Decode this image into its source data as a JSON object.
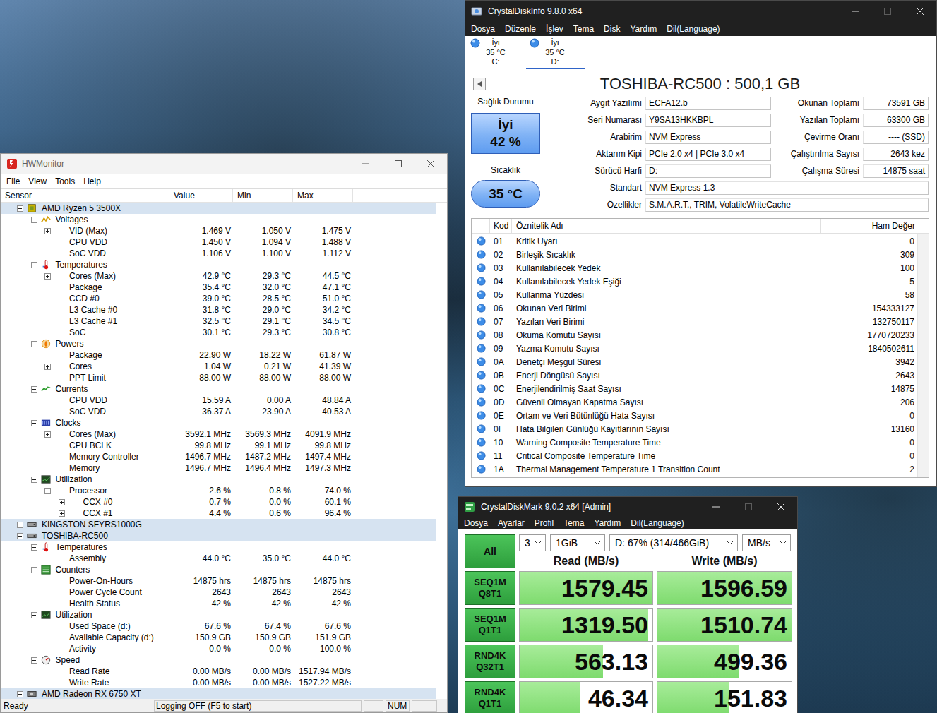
{
  "hwmonitor": {
    "title": "HWMonitor",
    "menu": [
      "File",
      "View",
      "Tools",
      "Help"
    ],
    "columns": [
      "Sensor",
      "Value",
      "Min",
      "Max"
    ],
    "rows": [
      {
        "label": "AMD Ryzen 5 3500X",
        "kind": "cpu",
        "level": 1,
        "expandable": true,
        "expanded": true
      },
      {
        "label": "Voltages",
        "kind": "voltages",
        "level": 2,
        "expandable": true,
        "expanded": true
      },
      {
        "label": "VID (Max)",
        "kind": "sensor",
        "level": 3,
        "expandable": true,
        "expanded": false,
        "value": "1.469 V",
        "min": "1.050 V",
        "max": "1.475 V"
      },
      {
        "label": "CPU VDD",
        "kind": "sensor",
        "level": 3,
        "expandable": false,
        "expanded": false,
        "value": "1.450 V",
        "min": "1.094 V",
        "max": "1.488 V"
      },
      {
        "label": "SoC VDD",
        "kind": "sensor",
        "level": 3,
        "expandable": false,
        "expanded": false,
        "value": "1.106 V",
        "min": "1.100 V",
        "max": "1.112 V"
      },
      {
        "label": "Temperatures",
        "kind": "temperatures",
        "level": 2,
        "expandable": true,
        "expanded": true
      },
      {
        "label": "Cores (Max)",
        "kind": "sensor",
        "level": 3,
        "expandable": true,
        "expanded": false,
        "value": "42.9 °C",
        "min": "29.3 °C",
        "max": "44.5 °C"
      },
      {
        "label": "Package",
        "kind": "sensor",
        "level": 3,
        "expandable": false,
        "expanded": false,
        "value": "35.4 °C",
        "min": "32.0 °C",
        "max": "47.1 °C"
      },
      {
        "label": "CCD #0",
        "kind": "sensor",
        "level": 3,
        "expandable": false,
        "expanded": false,
        "value": "39.0 °C",
        "min": "28.5 °C",
        "max": "51.0 °C"
      },
      {
        "label": "L3 Cache #0",
        "kind": "sensor",
        "level": 3,
        "expandable": false,
        "expanded": false,
        "value": "31.8 °C",
        "min": "29.0 °C",
        "max": "34.2 °C"
      },
      {
        "label": "L3 Cache #1",
        "kind": "sensor",
        "level": 3,
        "expandable": false,
        "expanded": false,
        "value": "32.5 °C",
        "min": "29.1 °C",
        "max": "34.5 °C"
      },
      {
        "label": "SoC",
        "kind": "sensor",
        "level": 3,
        "expandable": false,
        "expanded": false,
        "value": "30.1 °C",
        "min": "29.3 °C",
        "max": "30.8 °C"
      },
      {
        "label": "Powers",
        "kind": "powers",
        "level": 2,
        "expandable": true,
        "expanded": true
      },
      {
        "label": "Package",
        "kind": "sensor",
        "level": 3,
        "expandable": false,
        "expanded": false,
        "value": "22.90 W",
        "min": "18.22 W",
        "max": "61.87 W"
      },
      {
        "label": "Cores",
        "kind": "sensor",
        "level": 3,
        "expandable": true,
        "expanded": false,
        "value": "1.04 W",
        "min": "0.21 W",
        "max": "41.39 W"
      },
      {
        "label": "PPT Limit",
        "kind": "sensor",
        "level": 3,
        "expandable": false,
        "expanded": false,
        "value": "88.00 W",
        "min": "88.00 W",
        "max": "88.00 W"
      },
      {
        "label": "Currents",
        "kind": "currents",
        "level": 2,
        "expandable": true,
        "expanded": true
      },
      {
        "label": "CPU VDD",
        "kind": "sensor",
        "level": 3,
        "expandable": false,
        "expanded": false,
        "value": "15.59 A",
        "min": "0.00 A",
        "max": "48.84 A"
      },
      {
        "label": "SoC VDD",
        "kind": "sensor",
        "level": 3,
        "expandable": false,
        "expanded": false,
        "value": "36.37 A",
        "min": "23.90 A",
        "max": "40.53 A"
      },
      {
        "label": "Clocks",
        "kind": "clocks",
        "level": 2,
        "expandable": true,
        "expanded": true
      },
      {
        "label": "Cores (Max)",
        "kind": "sensor",
        "level": 3,
        "expandable": true,
        "expanded": false,
        "value": "3592.1 MHz",
        "min": "3569.3 MHz",
        "max": "4091.9 MHz"
      },
      {
        "label": "CPU BCLK",
        "kind": "sensor",
        "level": 3,
        "expandable": false,
        "expanded": false,
        "value": "99.8 MHz",
        "min": "99.1 MHz",
        "max": "99.8 MHz"
      },
      {
        "label": "Memory Controller",
        "kind": "sensor",
        "level": 3,
        "expandable": false,
        "expanded": false,
        "value": "1496.7 MHz",
        "min": "1487.2 MHz",
        "max": "1497.4 MHz"
      },
      {
        "label": "Memory",
        "kind": "sensor",
        "level": 3,
        "expandable": false,
        "expanded": false,
        "value": "1496.7 MHz",
        "min": "1496.4 MHz",
        "max": "1497.3 MHz"
      },
      {
        "label": "Utilization",
        "kind": "utilization",
        "level": 2,
        "expandable": true,
        "expanded": true
      },
      {
        "label": "Processor",
        "kind": "sensor",
        "level": 3,
        "expandable": true,
        "expanded": true,
        "value": "2.6 %",
        "min": "0.8 %",
        "max": "74.0 %"
      },
      {
        "label": "CCX #0",
        "kind": "sensor",
        "level": 4,
        "expandable": true,
        "expanded": false,
        "value": "0.7 %",
        "min": "0.0 %",
        "max": "60.1 %"
      },
      {
        "label": "CCX #1",
        "kind": "sensor",
        "level": 4,
        "expandable": true,
        "expanded": false,
        "value": "4.4 %",
        "min": "0.6 %",
        "max": "96.4 %"
      },
      {
        "label": "KINGSTON SFYRS1000G",
        "kind": "disk",
        "level": 1,
        "expandable": true,
        "expanded": false
      },
      {
        "label": "TOSHIBA-RC500",
        "kind": "disk",
        "level": 1,
        "expandable": true,
        "expanded": true
      },
      {
        "label": "Temperatures",
        "kind": "temperatures",
        "level": 2,
        "expandable": true,
        "expanded": true
      },
      {
        "label": "Assembly",
        "kind": "sensor",
        "level": 3,
        "expandable": false,
        "expanded": false,
        "value": "44.0 °C",
        "min": "35.0 °C",
        "max": "44.0 °C"
      },
      {
        "label": "Counters",
        "kind": "counters",
        "level": 2,
        "expandable": true,
        "expanded": true
      },
      {
        "label": "Power-On-Hours",
        "kind": "sensor",
        "level": 3,
        "expandable": false,
        "expanded": false,
        "value": "14875 hrs",
        "min": "14875 hrs",
        "max": "14875 hrs"
      },
      {
        "label": "Power Cycle Count",
        "kind": "sensor",
        "level": 3,
        "expandable": false,
        "expanded": false,
        "value": "2643",
        "min": "2643",
        "max": "2643"
      },
      {
        "label": "Health Status",
        "kind": "sensor",
        "level": 3,
        "expandable": false,
        "expanded": false,
        "value": "42 %",
        "min": "42 %",
        "max": "42 %"
      },
      {
        "label": "Utilization",
        "kind": "utilization",
        "level": 2,
        "expandable": true,
        "expanded": true
      },
      {
        "label": "Used Space (d:)",
        "kind": "sensor",
        "level": 3,
        "expandable": false,
        "expanded": false,
        "value": "67.6 %",
        "min": "67.4 %",
        "max": "67.6 %"
      },
      {
        "label": "Available Capacity (d:)",
        "kind": "sensor",
        "level": 3,
        "expandable": false,
        "expanded": false,
        "value": "150.9 GB",
        "min": "150.9 GB",
        "max": "151.9 GB"
      },
      {
        "label": "Activity",
        "kind": "sensor",
        "level": 3,
        "expandable": false,
        "expanded": false,
        "value": "0.0 %",
        "min": "0.0 %",
        "max": "100.0 %"
      },
      {
        "label": "Speed",
        "kind": "speed",
        "level": 2,
        "expandable": true,
        "expanded": true
      },
      {
        "label": "Read Rate",
        "kind": "sensor",
        "level": 3,
        "expandable": false,
        "expanded": false,
        "value": "0.00 MB/s",
        "min": "0.00 MB/s",
        "max": "1517.94 MB/s"
      },
      {
        "label": "Write Rate",
        "kind": "sensor",
        "level": 3,
        "expandable": false,
        "expanded": false,
        "value": "0.00 MB/s",
        "min": "0.00 MB/s",
        "max": "1527.22 MB/s"
      },
      {
        "label": "AMD Radeon RX 6750 XT",
        "kind": "gpu",
        "level": 1,
        "expandable": true,
        "expanded": false
      }
    ],
    "status": [
      "Ready",
      "Logging OFF (F5 to start)",
      "",
      "NUM",
      ""
    ]
  },
  "crystaldiskinfo": {
    "title": "CrystalDiskInfo 9.8.0 x64",
    "maximize_enabled": false,
    "menu": [
      "Dosya",
      "Düzenle",
      "İşlev",
      "Tema",
      "Disk",
      "Yardım",
      "Dil(Language)"
    ],
    "disks": [
      {
        "health": "İyi",
        "temp": "35 °C",
        "letter": "C:",
        "selected": false
      },
      {
        "health": "İyi",
        "temp": "35 °C",
        "letter": "D:",
        "selected": true
      }
    ],
    "model": "TOSHIBA-RC500 : 500,1 GB",
    "health": {
      "label": "Sağlık Durumu",
      "status": "İyi",
      "percent": "42 %"
    },
    "temperature": {
      "label": "Sıcaklık",
      "value": "35 °C"
    },
    "fields": [
      {
        "label": "Aygıt Yazılımı",
        "value": "ECFA12.b"
      },
      {
        "label": "Seri Numarası",
        "value": "Y9SA13HKKBPL"
      },
      {
        "label": "Arabirim",
        "value": "NVM Express"
      },
      {
        "label": "Aktarım Kipi",
        "value": "PCIe 2.0 x4 | PCIe 3.0 x4"
      },
      {
        "label": "Sürücü Harfi",
        "value": "D:"
      }
    ],
    "stats": [
      {
        "label": "Okunan Toplamı",
        "value": "73591 GB"
      },
      {
        "label": "Yazılan Toplamı",
        "value": "63300 GB"
      },
      {
        "label": "Çevirme Oranı",
        "value": "---- (SSD)"
      },
      {
        "label": "Çalıştırılma Sayısı",
        "value": "2643 kez"
      },
      {
        "label": "Çalışma Süresi",
        "value": "14875 saat"
      }
    ],
    "wide_fields": [
      {
        "label": "Standart",
        "value": "NVM Express 1.3"
      },
      {
        "label": "Özellikler",
        "value": "S.M.A.R.T., TRIM, VolatileWriteCache"
      }
    ],
    "smart": {
      "columns": [
        "Kod",
        "Öznitelik Adı",
        "Ham Değer"
      ],
      "rows": [
        {
          "code": "01",
          "name": "Kritik Uyarı",
          "raw": "0"
        },
        {
          "code": "02",
          "name": "Birleşik Sıcaklık",
          "raw": "309"
        },
        {
          "code": "03",
          "name": "Kullanılabilecek Yedek",
          "raw": "100"
        },
        {
          "code": "04",
          "name": "Kullanılabilecek Yedek Eşiği",
          "raw": "5"
        },
        {
          "code": "05",
          "name": "Kullanma Yüzdesi",
          "raw": "58"
        },
        {
          "code": "06",
          "name": "Okunan Veri Birimi",
          "raw": "154333127"
        },
        {
          "code": "07",
          "name": "Yazılan Veri Birimi",
          "raw": "132750117"
        },
        {
          "code": "08",
          "name": "Okuma Komutu Sayısı",
          "raw": "1770720233"
        },
        {
          "code": "09",
          "name": "Yazma Komutu Sayısı",
          "raw": "1840502611"
        },
        {
          "code": "0A",
          "name": "Denetçi Meşgul Süresi",
          "raw": "3942"
        },
        {
          "code": "0B",
          "name": "Enerji Döngüsü Sayısı",
          "raw": "2643"
        },
        {
          "code": "0C",
          "name": "Enerjilendirilmiş Saat Sayısı",
          "raw": "14875"
        },
        {
          "code": "0D",
          "name": "Güvenli Olmayan Kapatma Sayısı",
          "raw": "206"
        },
        {
          "code": "0E",
          "name": "Ortam ve Veri Bütünlüğü Hata Sayısı",
          "raw": "0"
        },
        {
          "code": "0F",
          "name": "Hata Bilgileri Günlüğü Kayıtlarının Sayısı",
          "raw": "13160"
        },
        {
          "code": "10",
          "name": "Warning Composite Temperature Time",
          "raw": "0"
        },
        {
          "code": "11",
          "name": "Critical Composite Temperature Time",
          "raw": "0"
        },
        {
          "code": "1A",
          "name": "Thermal Management Temperature 1 Transition Count",
          "raw": "2"
        }
      ]
    }
  },
  "crystaldiskmark": {
    "title": "CrystalDiskMark 9.0.2 x64 [Admin]",
    "maximize_enabled": false,
    "menu": [
      "Dosya",
      "Ayarlar",
      "Profil",
      "Tema",
      "Yardım",
      "Dil(Language)"
    ],
    "all_button": "All",
    "settings": [
      "3",
      "1GiB",
      "D: 67% (314/466GiB)",
      "MB/s"
    ],
    "headers": [
      "Read (MB/s)",
      "Write (MB/s)"
    ],
    "results": [
      {
        "test": "SEQ1M",
        "params": "Q8T1",
        "read": "1579.45",
        "write": "1596.59",
        "read_level": 1.0,
        "write_level": 1.0
      },
      {
        "test": "SEQ1M",
        "params": "Q1T1",
        "read": "1319.50",
        "write": "1510.74",
        "read_level": 0.97,
        "write_level": 1.0
      },
      {
        "test": "RND4K",
        "params": "Q32T1",
        "read": "563.13",
        "write": "499.36",
        "read_level": 0.63,
        "write_level": 0.61
      },
      {
        "test": "RND4K",
        "params": "Q1T1",
        "read": "46.34",
        "write": "151.83",
        "read_level": 0.45,
        "write_level": 0.53
      }
    ]
  }
}
